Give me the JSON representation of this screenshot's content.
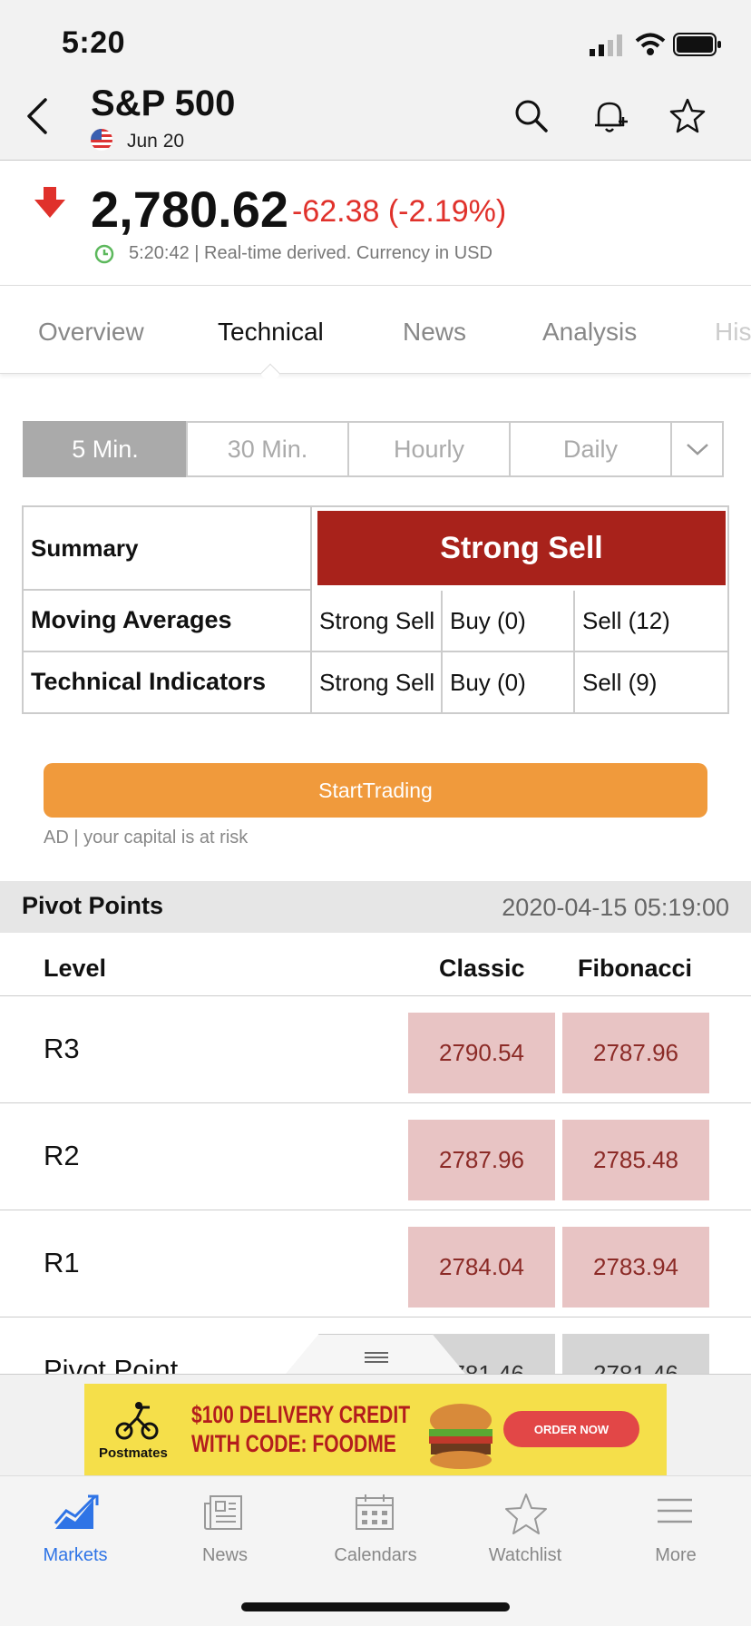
{
  "status_bar": {
    "time": "5:20"
  },
  "header": {
    "title": "S&P 500",
    "date": "Jun 20"
  },
  "quote": {
    "price": "2,780.62",
    "change": "-62.38 (-2.19%)",
    "meta": "5:20:42 | Real-time derived. Currency in USD",
    "colors": {
      "down": "#e0312b"
    }
  },
  "tabs": [
    {
      "label": "Overview"
    },
    {
      "label": "Technical"
    },
    {
      "label": "News"
    },
    {
      "label": "Analysis"
    },
    {
      "label": "His"
    }
  ],
  "timeframes": [
    "5 Min.",
    "30 Min.",
    "Hourly",
    "Daily"
  ],
  "summary": {
    "label": "Summary",
    "verdict": "Strong Sell",
    "verdict_color": "#a8221b",
    "rows": [
      {
        "name": "Moving Averages",
        "signal": "Strong Sell",
        "buy": "Buy (0)",
        "sell": "Sell (12)"
      },
      {
        "name": "Technical Indicators",
        "signal": "Strong Sell",
        "buy": "Buy (0)",
        "sell": "Sell (9)"
      }
    ]
  },
  "cta": {
    "label": "StartTrading",
    "disclaimer": "AD | your capital is at risk",
    "color": "#f09a3c"
  },
  "pivot": {
    "title": "Pivot Points",
    "date": "2020-04-15 05:19:00",
    "columns": {
      "level": "Level",
      "classic": "Classic",
      "fibonacci": "Fibonacci"
    },
    "rows": [
      {
        "level": "R3",
        "classic": "2790.54",
        "fibonacci": "2787.96"
      },
      {
        "level": "R2",
        "classic": "2787.96",
        "fibonacci": "2785.48"
      },
      {
        "level": "R1",
        "classic": "2784.04",
        "fibonacci": "2783.94"
      },
      {
        "level": "Pivot Point",
        "classic": "2781.46",
        "fibonacci": "2781.46"
      }
    ]
  },
  "ad": {
    "brand": "Postmates",
    "headline_line1": "$100 DELIVERY CREDIT",
    "headline_line2": "WITH CODE: FOODME",
    "button": "ORDER NOW"
  },
  "bottom_nav": [
    {
      "label": "Markets",
      "icon": "chart-icon"
    },
    {
      "label": "News",
      "icon": "newspaper-icon"
    },
    {
      "label": "Calendars",
      "icon": "calendar-icon"
    },
    {
      "label": "Watchlist",
      "icon": "star-icon"
    },
    {
      "label": "More",
      "icon": "menu-icon"
    }
  ],
  "accent": "#2f74e6"
}
